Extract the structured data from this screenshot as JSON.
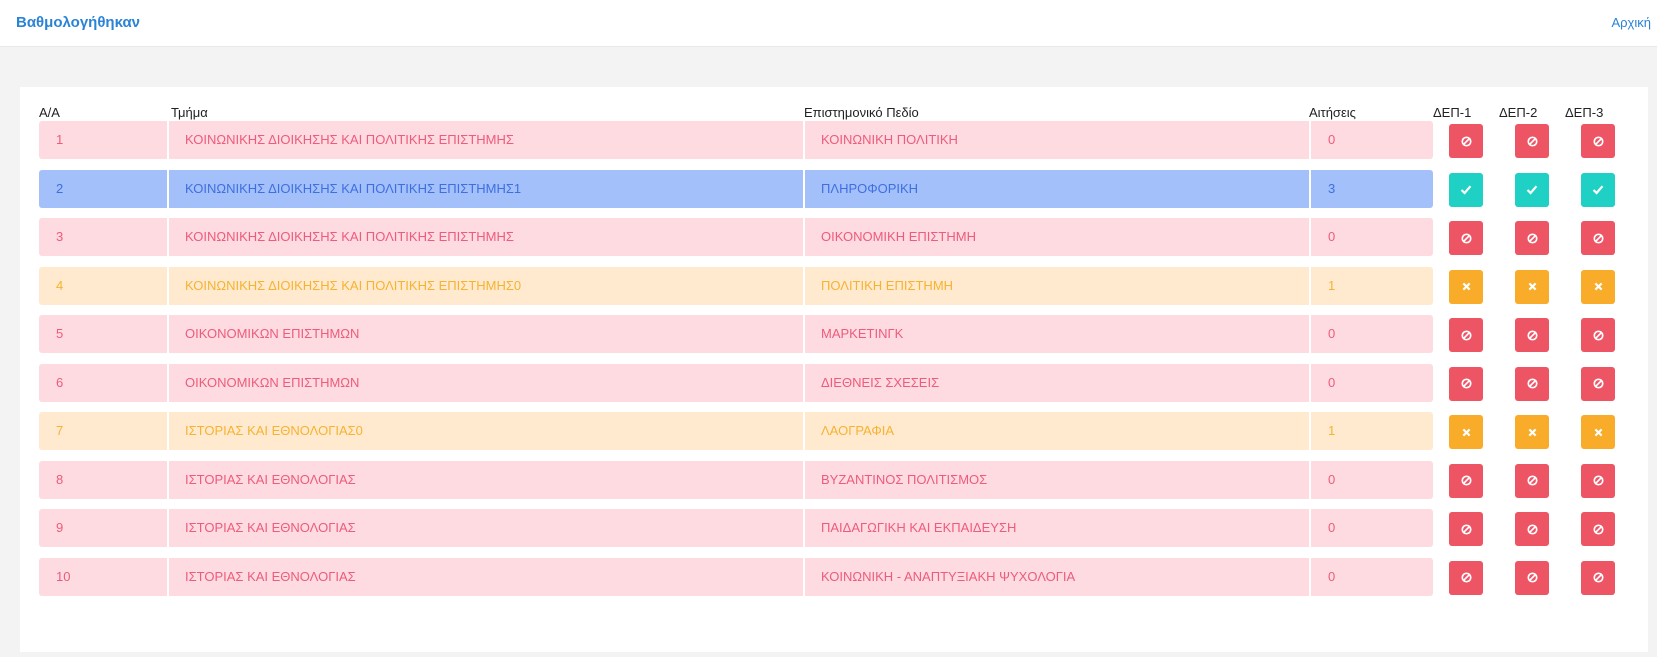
{
  "header": {
    "title": "Βαθμολογήθηκαν",
    "home_link": "Αρχική"
  },
  "table": {
    "headers": {
      "aa": "Α/Α",
      "department": "Τμήμα",
      "field": "Επιστημονικό Πεδίο",
      "applications": "Αιτήσεις",
      "dep1": "ΔΕΠ-1",
      "dep2": "ΔΕΠ-2",
      "dep3": "ΔΕΠ-3"
    },
    "rows": [
      {
        "aa": "1",
        "department": "ΚΟΙΝΩΝΙΚΗΣ ΔΙΟΙΚΗΣΗΣ ΚΑΙ ΠΟΛΙΤΙΚΗΣ ΕΠΙΣΤΗΜΗΣ",
        "field": "ΚΟΙΝΩΝΙΚΗ ΠΟΛΙΤΙΚΗ",
        "applications": "0",
        "status": "none"
      },
      {
        "aa": "2",
        "department": "ΚΟΙΝΩΝΙΚΗΣ ΔΙΟΙΚΗΣΗΣ ΚΑΙ ΠΟΛΙΤΙΚΗΣ ΕΠΙΣΤΗΜΗΣ1",
        "field": "ΠΛΗΡΟΦΟΡΙΚΗ",
        "applications": "3",
        "status": "graded"
      },
      {
        "aa": "3",
        "department": "ΚΟΙΝΩΝΙΚΗΣ ΔΙΟΙΚΗΣΗΣ ΚΑΙ ΠΟΛΙΤΙΚΗΣ ΕΠΙΣΤΗΜΗΣ",
        "field": "ΟΙΚΟΝΟΜΙΚΗ ΕΠΙΣΤΗΜΗ",
        "applications": "0",
        "status": "none"
      },
      {
        "aa": "4",
        "department": "ΚΟΙΝΩΝΙΚΗΣ ΔΙΟΙΚΗΣΗΣ ΚΑΙ ΠΟΛΙΤΙΚΗΣ ΕΠΙΣΤΗΜΗΣ0",
        "field": "ΠΟΛΙΤΙΚΗ ΕΠΙΣΤΗΜΗ",
        "applications": "1",
        "status": "pending"
      },
      {
        "aa": "5",
        "department": "ΟΙΚΟΝΟΜΙΚΩΝ ΕΠΙΣΤΗΜΩΝ",
        "field": "ΜΑΡΚΕΤΙΝΓΚ",
        "applications": "0",
        "status": "none"
      },
      {
        "aa": "6",
        "department": "ΟΙΚΟΝΟΜΙΚΩΝ ΕΠΙΣΤΗΜΩΝ",
        "field": "ΔΙΕΘΝΕΙΣ ΣΧΕΣΕΙΣ",
        "applications": "0",
        "status": "none"
      },
      {
        "aa": "7",
        "department": "ΙΣΤΟΡΙΑΣ ΚΑΙ ΕΘΝΟΛΟΓΙΑΣ0",
        "field": "ΛΑΟΓΡΑΦΙΑ",
        "applications": "1",
        "status": "pending"
      },
      {
        "aa": "8",
        "department": "ΙΣΤΟΡΙΑΣ ΚΑΙ ΕΘΝΟΛΟΓΙΑΣ",
        "field": "ΒΥΖΑΝΤΙΝΟΣ ΠΟΛΙΤΙΣΜΟΣ",
        "applications": "0",
        "status": "none"
      },
      {
        "aa": "9",
        "department": "ΙΣΤΟΡΙΑΣ ΚΑΙ ΕΘΝΟΛΟΓΙΑΣ",
        "field": "ΠΑΙΔΑΓΩΓΙΚΗ ΚΑΙ ΕΚΠΑΙΔΕΥΣΗ",
        "applications": "0",
        "status": "none"
      },
      {
        "aa": "10",
        "department": "ΙΣΤΟΡΙΑΣ ΚΑΙ ΕΘΝΟΛΟΓΙΑΣ",
        "field": "ΚΟΙΝΩΝΙΚΗ - ΑΝΑΠΤΥΞΙΑΚΗ ΨΥΧΟΛΟΓΙΑ",
        "applications": "0",
        "status": "none"
      }
    ]
  },
  "status_styles": {
    "none": {
      "row_color": "#fddbe0",
      "button_color": "#ed5565",
      "icon": "ban-icon"
    },
    "graded": {
      "row_color": "#a4c0fb",
      "button_color": "#1fd1c4",
      "icon": "check-icon"
    },
    "pending": {
      "row_color": "#ffeacf",
      "button_color": "#f8ac2a",
      "icon": "times-icon"
    }
  }
}
